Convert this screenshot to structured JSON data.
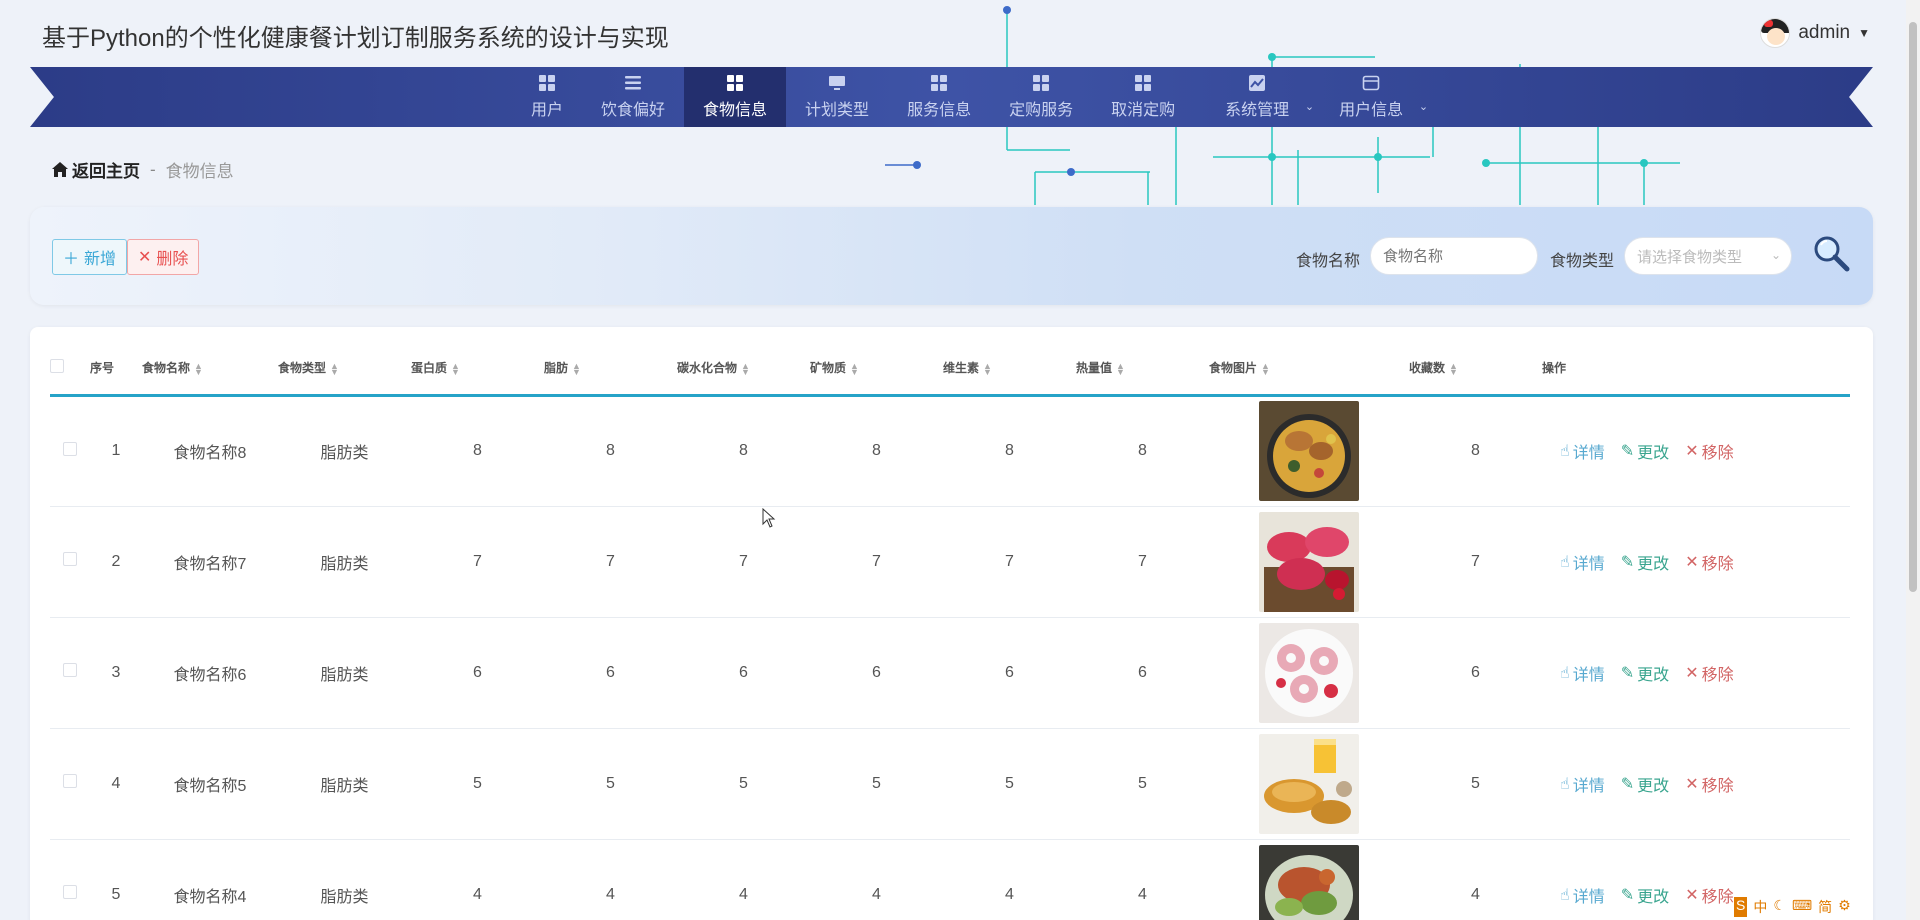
{
  "header": {
    "title": "基于Python的个性化健康餐计划订制服务系统的设计与实现",
    "username": "admin"
  },
  "nav": {
    "items": [
      {
        "label": "用户",
        "icon": "grid-icon"
      },
      {
        "label": "饮食偏好",
        "icon": "list-icon"
      },
      {
        "label": "食物信息",
        "icon": "grid-icon",
        "active": true
      },
      {
        "label": "计划类型",
        "icon": "monitor-icon"
      },
      {
        "label": "服务信息",
        "icon": "grid-icon"
      },
      {
        "label": "定购服务",
        "icon": "grid-icon"
      },
      {
        "label": "取消定购",
        "icon": "grid-icon"
      },
      {
        "label": "系统管理",
        "icon": "chart-icon",
        "has_submenu": true
      },
      {
        "label": "用户信息",
        "icon": "card-icon",
        "has_submenu": true
      }
    ]
  },
  "breadcrumb": {
    "home": "返回主页",
    "separator": "-",
    "current": "食物信息"
  },
  "toolbar": {
    "add_label": "新增",
    "delete_label": "删除"
  },
  "search": {
    "name_label": "食物名称",
    "name_placeholder": "食物名称",
    "type_label": "食物类型",
    "type_placeholder": "请选择食物类型"
  },
  "table": {
    "headers": [
      "序号",
      "食物名称",
      "食物类型",
      "蛋白质",
      "脂肪",
      "碳水化合物",
      "矿物质",
      "维生素",
      "热量值",
      "食物图片",
      "收藏数",
      "操作"
    ],
    "rows": [
      {
        "index": "1",
        "name": "食物名称8",
        "type": "脂肪类",
        "protein": "8",
        "fat": "8",
        "carbs": "8",
        "minerals": "8",
        "vitamins": "8",
        "calories": "8",
        "favorites": "8",
        "image": "paella-dish"
      },
      {
        "index": "2",
        "name": "食物名称7",
        "type": "脂肪类",
        "protein": "7",
        "fat": "7",
        "carbs": "7",
        "minerals": "7",
        "vitamins": "7",
        "calories": "7",
        "favorites": "7",
        "image": "pink-macarons"
      },
      {
        "index": "3",
        "name": "食物名称6",
        "type": "脂肪类",
        "protein": "6",
        "fat": "6",
        "carbs": "6",
        "minerals": "6",
        "vitamins": "6",
        "calories": "6",
        "favorites": "6",
        "image": "strawberry-donuts"
      },
      {
        "index": "4",
        "name": "食物名称5",
        "type": "脂肪类",
        "protein": "5",
        "fat": "5",
        "carbs": "5",
        "minerals": "5",
        "vitamins": "5",
        "calories": "5",
        "favorites": "5",
        "image": "croissant-breakfast"
      },
      {
        "index": "5",
        "name": "食物名称4",
        "type": "脂肪类",
        "protein": "4",
        "fat": "4",
        "carbs": "4",
        "minerals": "4",
        "vitamins": "4",
        "calories": "4",
        "favorites": "4",
        "image": "crab-salad"
      }
    ],
    "actions": {
      "detail": "详情",
      "edit": "更改",
      "remove": "移除"
    }
  },
  "ime": {
    "items": [
      "中",
      "简"
    ]
  },
  "colors": {
    "nav_bg": "#2c3c87",
    "nav_active": "#232f6e",
    "accent": "#26a3c8",
    "add": "#3aa7d6",
    "delete": "#e85050",
    "edit": "#3aa58f"
  }
}
